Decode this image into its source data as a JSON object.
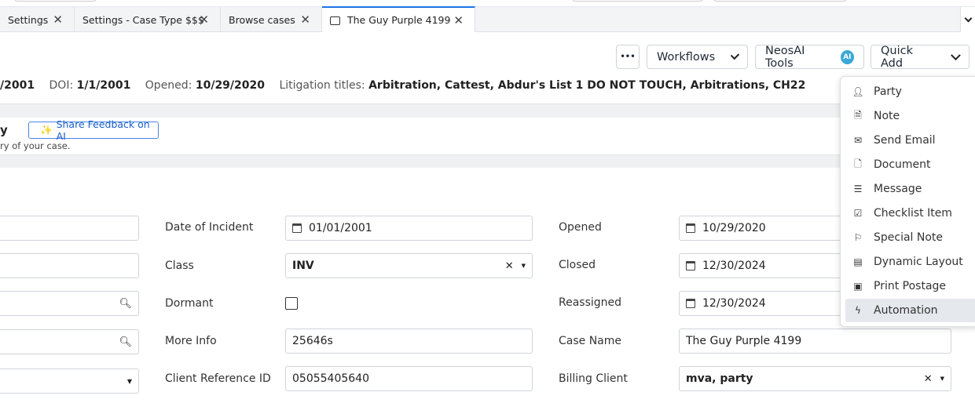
{
  "tabs": [
    {
      "label": "Settings"
    },
    {
      "label": "Settings - Case Type $$$"
    },
    {
      "label": "Browse cases"
    },
    {
      "label": "The Guy Purple 4199",
      "active": true
    }
  ],
  "toolbar": {
    "more": "•••",
    "workflows": "Workflows",
    "neosai": "NeosAI Tools",
    "ai_badge": "AI",
    "quick_add": "Quick Add"
  },
  "info": {
    "prefix_value": "/2001",
    "doi_label": "DOI:",
    "doi": "1/1/2001",
    "opened_label": "Opened:",
    "opened": "10/29/2020",
    "lit_label": "Litigation titles:",
    "lit": "Arbitration, Cattest, Abdur's List 1 DO NOT TOUCH, Arbitrations, CH22"
  },
  "ai": {
    "title_fragment": "y",
    "feedback": "Share Feedback on AI",
    "subtitle_fragment": "ry of your case."
  },
  "form": {
    "mid": [
      {
        "label": "Date of Incident",
        "value": "01/01/2001"
      },
      {
        "label": "Class",
        "value": "INV"
      },
      {
        "label": "Dormant"
      },
      {
        "label": "More Info",
        "value": "25646s"
      },
      {
        "label": "Client Reference ID",
        "value": "05055405640"
      }
    ],
    "right": [
      {
        "label": "Opened",
        "value": "10/29/2020"
      },
      {
        "label": "Closed",
        "value": "12/30/2024"
      },
      {
        "label": "Reassigned",
        "value": "12/30/2024"
      },
      {
        "label": "Case Name",
        "value": "The Guy Purple 4199"
      },
      {
        "label": "Billing Client",
        "value": "mva, party"
      }
    ]
  },
  "quick_add_menu": [
    {
      "label": "Party",
      "icon": "person-icon"
    },
    {
      "label": "Note",
      "icon": "note-icon"
    },
    {
      "label": "Send Email",
      "icon": "mail-icon"
    },
    {
      "label": "Document",
      "icon": "document-icon"
    },
    {
      "label": "Message",
      "icon": "message-icon"
    },
    {
      "label": "Checklist Item",
      "icon": "checklist-icon"
    },
    {
      "label": "Special Note",
      "icon": "flag-icon"
    },
    {
      "label": "Dynamic Layout",
      "icon": "layout-icon"
    },
    {
      "label": "Print Postage",
      "icon": "postage-icon"
    },
    {
      "label": "Automation",
      "icon": "bolt-icon",
      "highlighted": true
    }
  ]
}
